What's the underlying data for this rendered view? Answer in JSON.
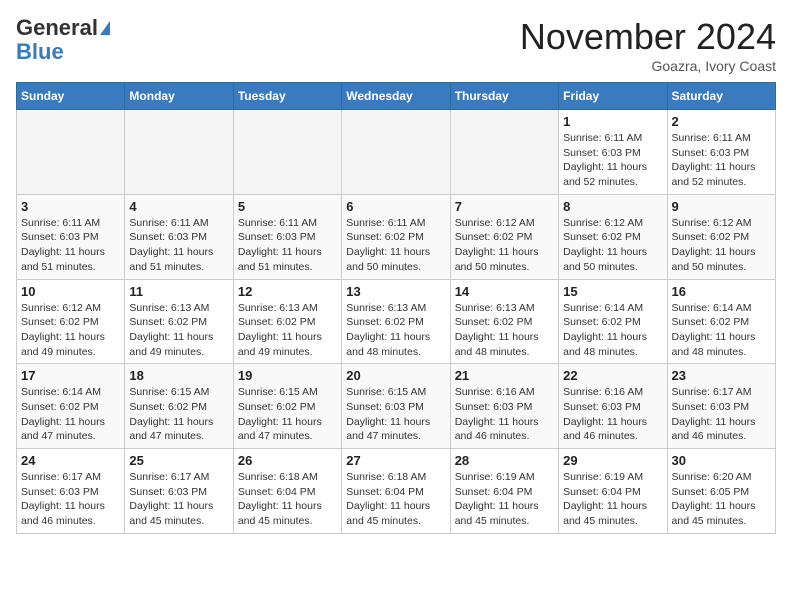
{
  "header": {
    "logo_general": "General",
    "logo_blue": "Blue",
    "month_title": "November 2024",
    "location": "Goazra, Ivory Coast"
  },
  "weekdays": [
    "Sunday",
    "Monday",
    "Tuesday",
    "Wednesday",
    "Thursday",
    "Friday",
    "Saturday"
  ],
  "weeks": [
    [
      {
        "day": "",
        "info": ""
      },
      {
        "day": "",
        "info": ""
      },
      {
        "day": "",
        "info": ""
      },
      {
        "day": "",
        "info": ""
      },
      {
        "day": "",
        "info": ""
      },
      {
        "day": "1",
        "info": "Sunrise: 6:11 AM\nSunset: 6:03 PM\nDaylight: 11 hours\nand 52 minutes."
      },
      {
        "day": "2",
        "info": "Sunrise: 6:11 AM\nSunset: 6:03 PM\nDaylight: 11 hours\nand 52 minutes."
      }
    ],
    [
      {
        "day": "3",
        "info": "Sunrise: 6:11 AM\nSunset: 6:03 PM\nDaylight: 11 hours\nand 51 minutes."
      },
      {
        "day": "4",
        "info": "Sunrise: 6:11 AM\nSunset: 6:03 PM\nDaylight: 11 hours\nand 51 minutes."
      },
      {
        "day": "5",
        "info": "Sunrise: 6:11 AM\nSunset: 6:03 PM\nDaylight: 11 hours\nand 51 minutes."
      },
      {
        "day": "6",
        "info": "Sunrise: 6:11 AM\nSunset: 6:02 PM\nDaylight: 11 hours\nand 50 minutes."
      },
      {
        "day": "7",
        "info": "Sunrise: 6:12 AM\nSunset: 6:02 PM\nDaylight: 11 hours\nand 50 minutes."
      },
      {
        "day": "8",
        "info": "Sunrise: 6:12 AM\nSunset: 6:02 PM\nDaylight: 11 hours\nand 50 minutes."
      },
      {
        "day": "9",
        "info": "Sunrise: 6:12 AM\nSunset: 6:02 PM\nDaylight: 11 hours\nand 50 minutes."
      }
    ],
    [
      {
        "day": "10",
        "info": "Sunrise: 6:12 AM\nSunset: 6:02 PM\nDaylight: 11 hours\nand 49 minutes."
      },
      {
        "day": "11",
        "info": "Sunrise: 6:13 AM\nSunset: 6:02 PM\nDaylight: 11 hours\nand 49 minutes."
      },
      {
        "day": "12",
        "info": "Sunrise: 6:13 AM\nSunset: 6:02 PM\nDaylight: 11 hours\nand 49 minutes."
      },
      {
        "day": "13",
        "info": "Sunrise: 6:13 AM\nSunset: 6:02 PM\nDaylight: 11 hours\nand 48 minutes."
      },
      {
        "day": "14",
        "info": "Sunrise: 6:13 AM\nSunset: 6:02 PM\nDaylight: 11 hours\nand 48 minutes."
      },
      {
        "day": "15",
        "info": "Sunrise: 6:14 AM\nSunset: 6:02 PM\nDaylight: 11 hours\nand 48 minutes."
      },
      {
        "day": "16",
        "info": "Sunrise: 6:14 AM\nSunset: 6:02 PM\nDaylight: 11 hours\nand 48 minutes."
      }
    ],
    [
      {
        "day": "17",
        "info": "Sunrise: 6:14 AM\nSunset: 6:02 PM\nDaylight: 11 hours\nand 47 minutes."
      },
      {
        "day": "18",
        "info": "Sunrise: 6:15 AM\nSunset: 6:02 PM\nDaylight: 11 hours\nand 47 minutes."
      },
      {
        "day": "19",
        "info": "Sunrise: 6:15 AM\nSunset: 6:02 PM\nDaylight: 11 hours\nand 47 minutes."
      },
      {
        "day": "20",
        "info": "Sunrise: 6:15 AM\nSunset: 6:03 PM\nDaylight: 11 hours\nand 47 minutes."
      },
      {
        "day": "21",
        "info": "Sunrise: 6:16 AM\nSunset: 6:03 PM\nDaylight: 11 hours\nand 46 minutes."
      },
      {
        "day": "22",
        "info": "Sunrise: 6:16 AM\nSunset: 6:03 PM\nDaylight: 11 hours\nand 46 minutes."
      },
      {
        "day": "23",
        "info": "Sunrise: 6:17 AM\nSunset: 6:03 PM\nDaylight: 11 hours\nand 46 minutes."
      }
    ],
    [
      {
        "day": "24",
        "info": "Sunrise: 6:17 AM\nSunset: 6:03 PM\nDaylight: 11 hours\nand 46 minutes."
      },
      {
        "day": "25",
        "info": "Sunrise: 6:17 AM\nSunset: 6:03 PM\nDaylight: 11 hours\nand 45 minutes."
      },
      {
        "day": "26",
        "info": "Sunrise: 6:18 AM\nSunset: 6:04 PM\nDaylight: 11 hours\nand 45 minutes."
      },
      {
        "day": "27",
        "info": "Sunrise: 6:18 AM\nSunset: 6:04 PM\nDaylight: 11 hours\nand 45 minutes."
      },
      {
        "day": "28",
        "info": "Sunrise: 6:19 AM\nSunset: 6:04 PM\nDaylight: 11 hours\nand 45 minutes."
      },
      {
        "day": "29",
        "info": "Sunrise: 6:19 AM\nSunset: 6:04 PM\nDaylight: 11 hours\nand 45 minutes."
      },
      {
        "day": "30",
        "info": "Sunrise: 6:20 AM\nSunset: 6:05 PM\nDaylight: 11 hours\nand 45 minutes."
      }
    ]
  ]
}
